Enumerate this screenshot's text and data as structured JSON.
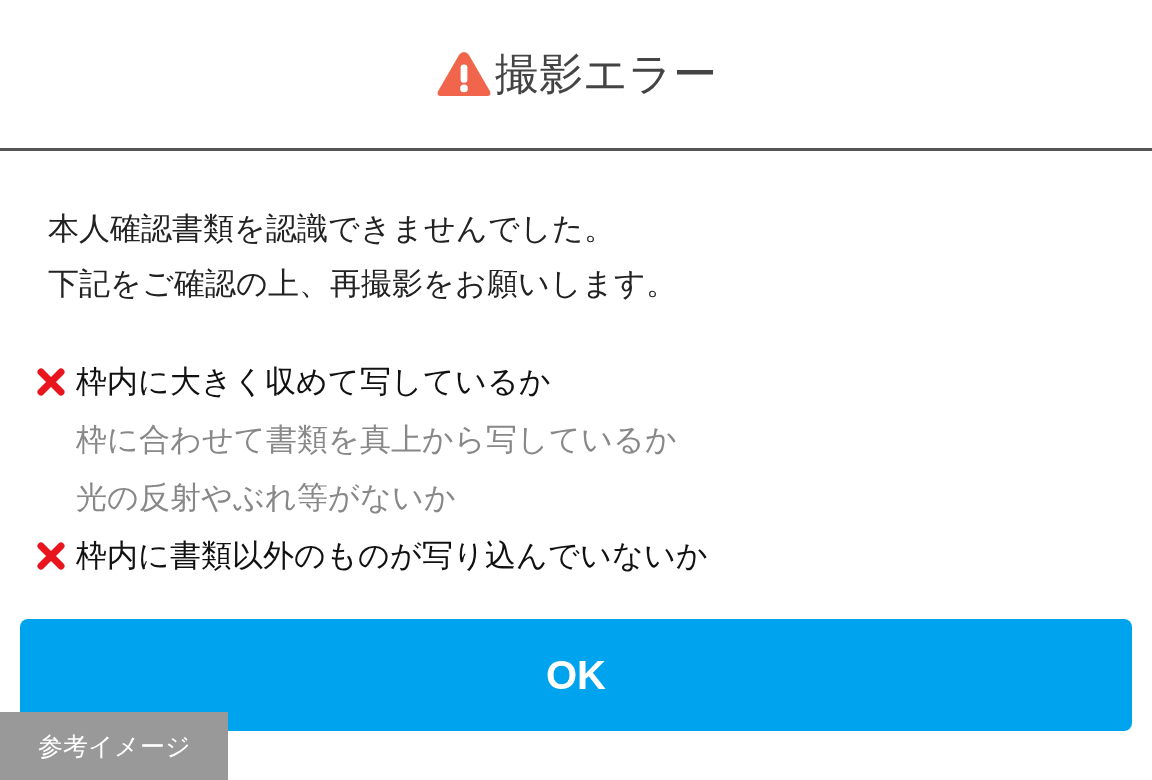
{
  "dialog": {
    "title": "撮影エラー",
    "message": [
      "本人確認書類を認識できませんでした。",
      "下記をご確認の上、再撮影をお願いします。"
    ],
    "checklist": [
      {
        "label": "枠内に大きく収めて写しているか",
        "failed": true
      },
      {
        "label": "枠に合わせて書類を真上から写しているか",
        "failed": false
      },
      {
        "label": "光の反射やぶれ等がないか",
        "failed": false
      },
      {
        "label": "枠内に書類以外のものが写り込んでいないか",
        "failed": true
      }
    ],
    "button": "OK"
  },
  "overlay_label": "参考イメージ"
}
